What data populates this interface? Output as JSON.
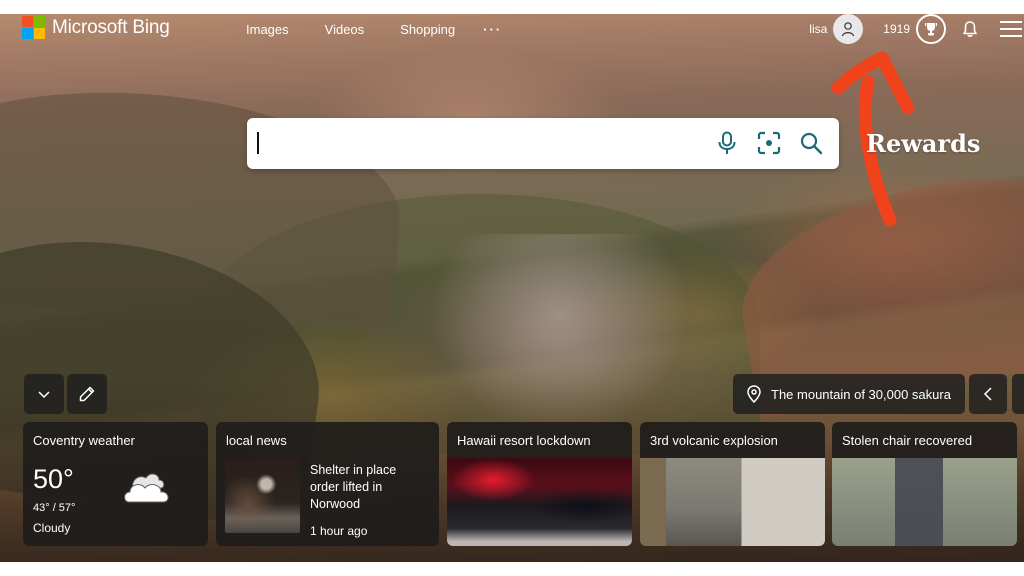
{
  "header": {
    "brand": "Microsoft Bing",
    "logo_colors": [
      "#f25022",
      "#7fba00",
      "#00a4ef",
      "#ffb900"
    ],
    "nav": [
      {
        "label": "Images"
      },
      {
        "label": "Videos"
      },
      {
        "label": "Shopping"
      },
      {
        "label": "···"
      }
    ],
    "user_name": "lisa",
    "rewards_points": "1919",
    "icons": [
      "user-icon",
      "rewards-trophy-icon",
      "bell-icon",
      "hamburger-menu-icon"
    ]
  },
  "search": {
    "value": "",
    "placeholder": "",
    "icons": [
      "microphone-icon",
      "visual-search-icon",
      "search-icon"
    ],
    "icon_color": "#1a6a78"
  },
  "annotation": {
    "label": "Rewards",
    "arrow_color": "#f0431c"
  },
  "controls": {
    "collapse_icon": "chevron-down-icon",
    "edit_icon": "pencil-icon",
    "image_caption": "The mountain of 30,000 sakura",
    "location_icon": "location-pin-icon",
    "prev_icon": "chevron-left-icon"
  },
  "cards": {
    "weather": {
      "title": "Coventry weather",
      "temperature": "50°",
      "range": "43° / 57°",
      "condition": "Cloudy",
      "icon": "cloud-icon"
    },
    "local_news": {
      "title": "local news",
      "headline": "Shelter in place order lifted in Norwood",
      "time": "1 hour ago"
    },
    "news": [
      {
        "title": "Hawaii resort lockdown"
      },
      {
        "title": "3rd volcanic explosion"
      },
      {
        "title": "Stolen chair recovered"
      }
    ]
  }
}
